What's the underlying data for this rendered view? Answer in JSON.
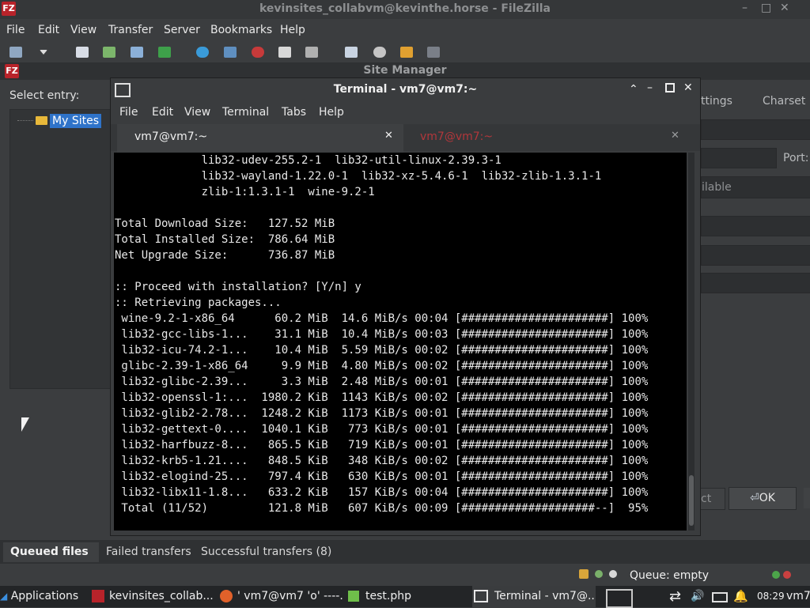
{
  "filezilla": {
    "title": "kevinsites_collabvm@kevinthe.horse - FileZilla",
    "menu": [
      "File",
      "Edit",
      "View",
      "Transfer",
      "Server",
      "Bookmarks",
      "Help"
    ]
  },
  "site_manager": {
    "title": "Site Manager",
    "select_entry": "Select entry:",
    "tree_root": "My Sites",
    "tabs_partial": [
      "ttings",
      "Charset"
    ],
    "port_label": "Port:",
    "partial_text": "ilable",
    "ok_label": "OK",
    "cancel_partial": "ct"
  },
  "terminal": {
    "window_title": "Terminal - vm7@vm7:~",
    "menu": [
      "File",
      "Edit",
      "View",
      "Terminal",
      "Tabs",
      "Help"
    ],
    "tabs": [
      {
        "label": "vm7@vm7:~",
        "active": true
      },
      {
        "label": "vm7@vm7:~",
        "active": false
      }
    ],
    "lines": [
      "             lib32-udev-255.2-1  lib32-util-linux-2.39.3-1",
      "             lib32-wayland-1.22.0-1  lib32-xz-5.4.6-1  lib32-zlib-1.3.1-1",
      "             zlib-1:1.3.1-1  wine-9.2-1",
      "",
      "Total Download Size:   127.52 MiB",
      "Total Installed Size:  786.64 MiB",
      "Net Upgrade Size:      736.87 MiB",
      "",
      ":: Proceed with installation? [Y/n] y",
      ":: Retrieving packages...",
      " wine-9.2-1-x86_64      60.2 MiB  14.6 MiB/s 00:04 [######################] 100%",
      " lib32-gcc-libs-1...    31.1 MiB  10.4 MiB/s 00:03 [######################] 100%",
      " lib32-icu-74.2-1...    10.4 MiB  5.59 MiB/s 00:02 [######################] 100%",
      " glibc-2.39-1-x86_64     9.9 MiB  4.80 MiB/s 00:02 [######################] 100%",
      " lib32-glibc-2.39...     3.3 MiB  2.48 MiB/s 00:01 [######################] 100%",
      " lib32-openssl-1:...  1980.2 KiB  1143 KiB/s 00:02 [######################] 100%",
      " lib32-glib2-2.78...  1248.2 KiB  1173 KiB/s 00:01 [######################] 100%",
      " lib32-gettext-0....  1040.1 KiB   773 KiB/s 00:01 [######################] 100%",
      " lib32-harfbuzz-8...   865.5 KiB   719 KiB/s 00:01 [######################] 100%",
      " lib32-krb5-1.21....   848.5 KiB   348 KiB/s 00:02 [######################] 100%",
      " lib32-elogind-25...   797.4 KiB   630 KiB/s 00:01 [######################] 100%",
      " lib32-libx11-1.8...   633.2 KiB   157 KiB/s 00:04 [######################] 100%",
      " Total (11/52)         121.8 MiB   607 KiB/s 00:09 [####################--]  95%"
    ]
  },
  "queue_tabs": [
    "Queued files",
    "Failed transfers",
    "Successful transfers (8)"
  ],
  "status": {
    "queue": "Queue: empty"
  },
  "taskbar": {
    "applications": "Applications",
    "items": [
      "kevinsites_collab...",
      "' vm7@vm7 'o' ----...",
      "test.php",
      "Terminal - vm7@..."
    ],
    "clock": "08:29",
    "user": "vm7"
  },
  "colors": {
    "accent": "#2f73c9",
    "terminal_bg": "#000000",
    "inactive_tab_text": "#b2373b"
  }
}
